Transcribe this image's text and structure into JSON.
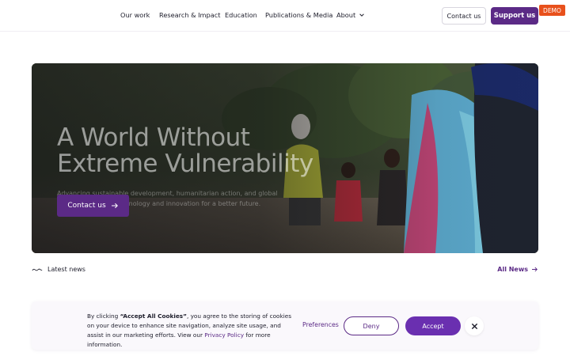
{
  "nav": {
    "items": [
      {
        "label": "Our work"
      },
      {
        "label": "Research & Impact"
      },
      {
        "label": "Education"
      },
      {
        "label": "Publications & Media"
      },
      {
        "label": "About"
      }
    ],
    "about_icon": "chevron-down-icon",
    "contact_label": "Contact us",
    "support_label": "Support us",
    "demo_badge": "DEMO"
  },
  "hero": {
    "title_line1": "A World Without",
    "title_line2": "Extreme Vulnerability",
    "subtitle": "Advancing sustainable development, humanitarian action, and global peace. promoting technology and innovation for a better future.",
    "button_label": "Contact us",
    "button_icon": "arrow-right-icon"
  },
  "news": {
    "section_label": "Latest news",
    "section_icon": "wave-icon",
    "all_label": "All News",
    "all_icon": "arrow-right-icon"
  },
  "cookie": {
    "text_prefix": "By clicking ",
    "text_bold": "“Accept All Cookies”",
    "text_mid": ", you agree to the storing of cookies on your device to enhance site navigation, analyze site usage, and assist in our marketing efforts. View our ",
    "link_label": "Privacy Policy",
    "text_suffix": " for more information.",
    "preferences_label": "Preferences",
    "deny_label": "Deny",
    "accept_label": "Accept",
    "close_icon": "close-icon"
  },
  "colors": {
    "brand_purple": "#5b2a86",
    "accept_purple": "#6a2fb0",
    "demo_orange": "#e8511c"
  }
}
